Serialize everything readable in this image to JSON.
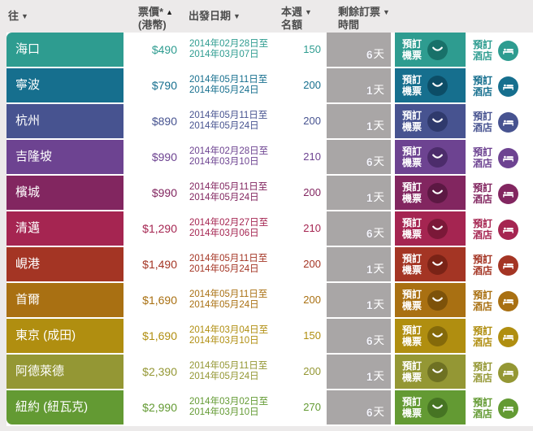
{
  "page": {
    "background": "#ECEAEA",
    "time_box_color": "#A9A6A6"
  },
  "header": {
    "to_label": "往",
    "fare_label": "票價*",
    "fare_sub_label": "(港幣)",
    "dates_label": "出發日期",
    "quota_label_line1": "本週",
    "quota_label_line2": "名額",
    "time_label_line1": "剩餘訂票",
    "time_label_line2": "時間",
    "sort_down_icon": "▼",
    "sort_up_icon": "▲"
  },
  "buttons": {
    "flight_line1": "預訂",
    "flight_line2": "機票",
    "hotel_line1": "預訂",
    "hotel_line2": "酒店"
  },
  "labels": {
    "day_unit": "天"
  },
  "rows": [
    {
      "destination": "海口",
      "fare": "$490",
      "date_from": "2014年02月28日至",
      "date_to": "2014年03月07日",
      "quota": "150",
      "days": "6",
      "color": "#2E9C90",
      "dark_color": "#187169"
    },
    {
      "destination": "寧波",
      "fare": "$790",
      "date_from": "2014年05月11日至",
      "date_to": "2014年05月24日",
      "quota": "200",
      "days": "1",
      "color": "#166F8E",
      "dark_color": "#0C4D66"
    },
    {
      "destination": "杭州",
      "fare": "$890",
      "date_from": "2014年05月11日至",
      "date_to": "2014年05月24日",
      "quota": "200",
      "days": "1",
      "color": "#475390",
      "dark_color": "#2F3A6C"
    },
    {
      "destination": "吉隆坡",
      "fare": "$990",
      "date_from": "2014年02月28日至",
      "date_to": "2014年03月10日",
      "quota": "210",
      "days": "6",
      "color": "#6D4391",
      "dark_color": "#4C2C6B"
    },
    {
      "destination": "檳城",
      "fare": "$990",
      "date_from": "2014年05月11日至",
      "date_to": "2014年05月24日",
      "quota": "200",
      "days": "1",
      "color": "#822660",
      "dark_color": "#5C1843"
    },
    {
      "destination": "清邁",
      "fare": "$1,290",
      "date_from": "2014年02月27日至",
      "date_to": "2014年03月06日",
      "quota": "210",
      "days": "6",
      "color": "#A52551",
      "dark_color": "#7B1838"
    },
    {
      "destination": "峴港",
      "fare": "$1,490",
      "date_from": "2014年05月11日至",
      "date_to": "2014年05月24日",
      "quota": "200",
      "days": "1",
      "color": "#A43524",
      "dark_color": "#7A2316"
    },
    {
      "destination": "首爾",
      "fare": "$1,690",
      "date_from": "2014年05月11日至",
      "date_to": "2014年05月24日",
      "quota": "200",
      "days": "1",
      "color": "#A97012",
      "dark_color": "#7D520A"
    },
    {
      "destination": "東京 (成田)",
      "fare": "$1,690",
      "date_from": "2014年03月04日至",
      "date_to": "2014年03月10日",
      "quota": "150",
      "days": "6",
      "color": "#B08E10",
      "dark_color": "#84690A"
    },
    {
      "destination": "阿德萊德",
      "fare": "$2,390",
      "date_from": "2014年05月11日至",
      "date_to": "2014年05月24日",
      "quota": "200",
      "days": "1",
      "color": "#949734",
      "dark_color": "#6E7123"
    },
    {
      "destination": "紐約 (紐瓦克)",
      "fare": "$2,990",
      "date_from": "2014年03月02日至",
      "date_to": "2014年03月10日",
      "quota": "270",
      "days": "6",
      "color": "#639A33",
      "dark_color": "#467423"
    }
  ]
}
